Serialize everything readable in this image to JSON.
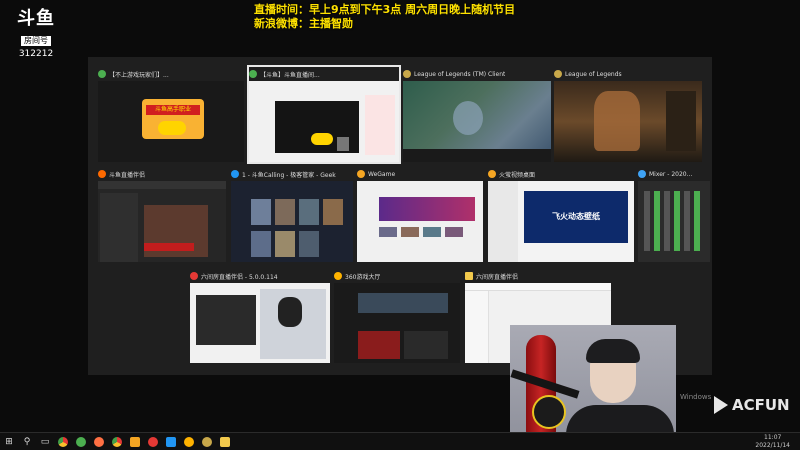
{
  "overlay": {
    "logo_mark": "斗鱼",
    "logo_sub": "房间号",
    "room_number": "312212",
    "notice_line1": "直播时间：早上9点到下午3点  周六周日晚上随机节目",
    "notice_line2": "新浪微博：主播智勋",
    "notice_tiny": "FUN"
  },
  "windows": [
    {
      "title": "【不上游戏玩家们】...",
      "icon": "browser-icon",
      "color": "#4caf50"
    },
    {
      "title": "【斗鱼】斗鱼直播间...",
      "icon": "browser-icon",
      "color": "#4caf50"
    },
    {
      "title": "League of Legends (TM) Client",
      "icon": "lol-icon",
      "color": "#c8a84a"
    },
    {
      "title": "League of Legends",
      "icon": "lol-icon",
      "color": "#c8a84a"
    },
    {
      "title": "斗鱼直播伴侣",
      "icon": "douyu-icon",
      "color": "#ff6a00"
    },
    {
      "title": "1 - 斗鱼Calling - 极客管家 - Geek",
      "icon": "geek-icon",
      "color": "#2196f3"
    },
    {
      "title": "WeGame",
      "icon": "wegame-icon",
      "color": "#f5a623"
    },
    {
      "title": "火萤视频桌面",
      "icon": "huoying-icon",
      "color": "#f5a623"
    },
    {
      "title": "Mixer - 2020...",
      "icon": "mixer-icon",
      "color": "#3fa3f5"
    },
    {
      "title": "六间房直播伴侣 - 5.0.0.114",
      "icon": "liujianfang-icon",
      "color": "#e53935"
    },
    {
      "title": "360游戏大厅",
      "icon": "game-center-icon",
      "color": "#ffb300"
    },
    {
      "title": "六间房直播伴侣",
      "icon": "folder-icon",
      "color": "#f2c94c"
    }
  ],
  "thumb_texts": {
    "hero_banner": "斗鱼高手职业",
    "huoying_brand": "飞火动态壁纸"
  },
  "watermark": {
    "line1": "Windows",
    "line2": "Windows"
  },
  "acfun": "ACFUN",
  "taskbar": {
    "time": "11:07",
    "date": "2022/11/14",
    "icons": [
      "windows-start-icon",
      "search-icon",
      "task-view-icon",
      "chrome-icon",
      "douyu-icon",
      "browser-icon",
      "chrome-icon",
      "wegame-icon",
      "liujianfang-icon",
      "geek-icon",
      "game-center-icon",
      "lol-icon",
      "folder-icon"
    ]
  }
}
